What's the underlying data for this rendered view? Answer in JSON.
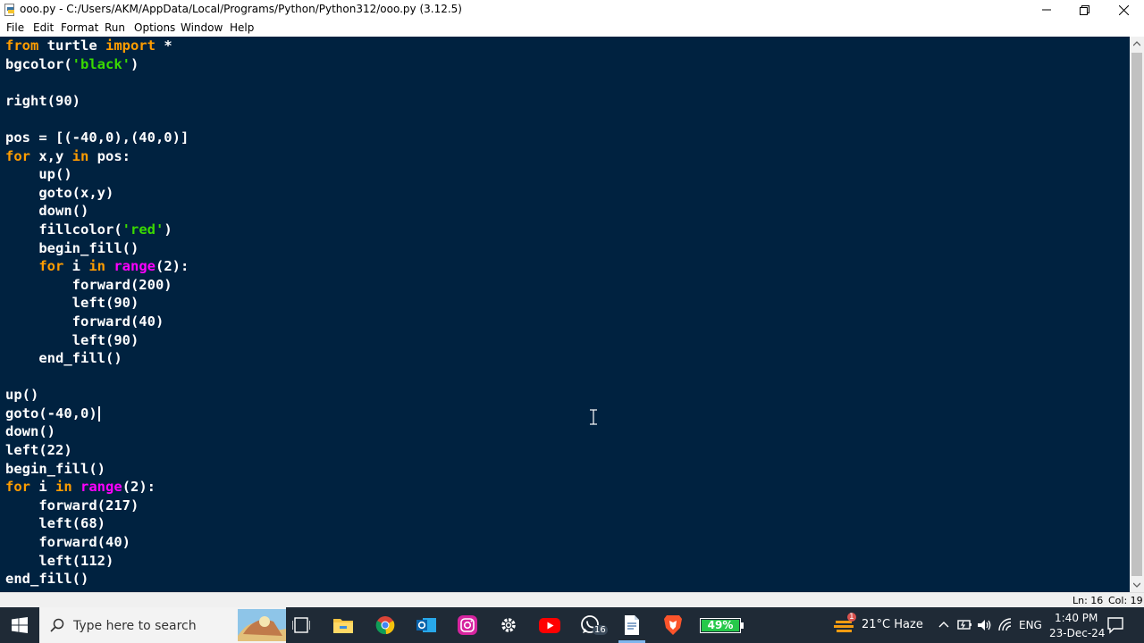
{
  "window": {
    "title": "ooo.py - C:/Users/AKM/AppData/Local/Programs/Python/Python312/ooo.py (3.12.5)",
    "controls": {
      "minimize_icon": "minimize-icon",
      "maximize_icon": "restore-icon",
      "close_icon": "close-icon"
    }
  },
  "menu": {
    "items": [
      "File",
      "Edit",
      "Format",
      "Run",
      "Options",
      "Window",
      "Help"
    ]
  },
  "editor": {
    "background": "#002240",
    "colors": {
      "keyword": "#ff9d00",
      "string": "#3ad900",
      "builtin": "#ff00ff",
      "default": "#ffffff"
    },
    "lines": [
      [
        {
          "t": "from",
          "c": "kw"
        },
        {
          "t": " turtle ",
          "c": ""
        },
        {
          "t": "import",
          "c": "kw"
        },
        {
          "t": " *",
          "c": ""
        }
      ],
      [
        {
          "t": "bgcolor(",
          "c": ""
        },
        {
          "t": "'black'",
          "c": "str"
        },
        {
          "t": ")",
          "c": ""
        }
      ],
      [],
      [
        {
          "t": "right(90)",
          "c": ""
        }
      ],
      [],
      [
        {
          "t": "pos = [(-40,0),(40,0)]",
          "c": ""
        }
      ],
      [
        {
          "t": "for",
          "c": "kw"
        },
        {
          "t": " x,y ",
          "c": ""
        },
        {
          "t": "in",
          "c": "kw"
        },
        {
          "t": " pos:",
          "c": ""
        }
      ],
      [
        {
          "t": "    up()",
          "c": ""
        }
      ],
      [
        {
          "t": "    goto(x,y)",
          "c": ""
        }
      ],
      [
        {
          "t": "    down()",
          "c": ""
        }
      ],
      [
        {
          "t": "    fillcolor(",
          "c": ""
        },
        {
          "t": "'red'",
          "c": "str"
        },
        {
          "t": ")",
          "c": ""
        }
      ],
      [
        {
          "t": "    begin_fill()",
          "c": ""
        }
      ],
      [
        {
          "t": "    ",
          "c": ""
        },
        {
          "t": "for",
          "c": "kw"
        },
        {
          "t": " i ",
          "c": ""
        },
        {
          "t": "in",
          "c": "kw"
        },
        {
          "t": " ",
          "c": ""
        },
        {
          "t": "range",
          "c": "bi"
        },
        {
          "t": "(2):",
          "c": ""
        }
      ],
      [
        {
          "t": "        forward(200)",
          "c": ""
        }
      ],
      [
        {
          "t": "        left(90)",
          "c": ""
        }
      ],
      [
        {
          "t": "        forward(40)",
          "c": ""
        }
      ],
      [
        {
          "t": "        left(90)",
          "c": ""
        }
      ],
      [
        {
          "t": "    end_fill()",
          "c": ""
        }
      ],
      [],
      [
        {
          "t": "up()",
          "c": ""
        }
      ],
      [
        {
          "t": "goto(-40,0)",
          "c": ""
        }
      ],
      [
        {
          "t": "down()",
          "c": ""
        }
      ],
      [
        {
          "t": "left(22)",
          "c": ""
        }
      ],
      [
        {
          "t": "begin_fill()",
          "c": ""
        }
      ],
      [
        {
          "t": "for",
          "c": "kw"
        },
        {
          "t": " i ",
          "c": ""
        },
        {
          "t": "in",
          "c": "kw"
        },
        {
          "t": " ",
          "c": ""
        },
        {
          "t": "range",
          "c": "bi"
        },
        {
          "t": "(2):",
          "c": ""
        }
      ],
      [
        {
          "t": "    forward(217)",
          "c": ""
        }
      ],
      [
        {
          "t": "    left(68)",
          "c": ""
        }
      ],
      [
        {
          "t": "    forward(40)",
          "c": ""
        }
      ],
      [
        {
          "t": "    left(112)",
          "c": ""
        }
      ],
      [
        {
          "t": "end_fill()",
          "c": ""
        }
      ]
    ],
    "caret_line": 20
  },
  "status": {
    "line": "Ln: 16",
    "col": "Col: 19"
  },
  "taskbar": {
    "search_placeholder": "Type here to search",
    "apps": [
      "task-view-icon",
      "file-explorer-icon",
      "chrome-icon",
      "outlook-icon",
      "instagram-icon",
      "settings-icon",
      "youtube-icon",
      "whatsapp-icon",
      "document-icon",
      "brave-icon"
    ],
    "whatsapp_badge": "16",
    "battery": "49%",
    "weather": "21°C  Haze",
    "weather_badge": "1",
    "language": "ENG",
    "time": "1:40 PM",
    "date": "23-Dec-24"
  }
}
